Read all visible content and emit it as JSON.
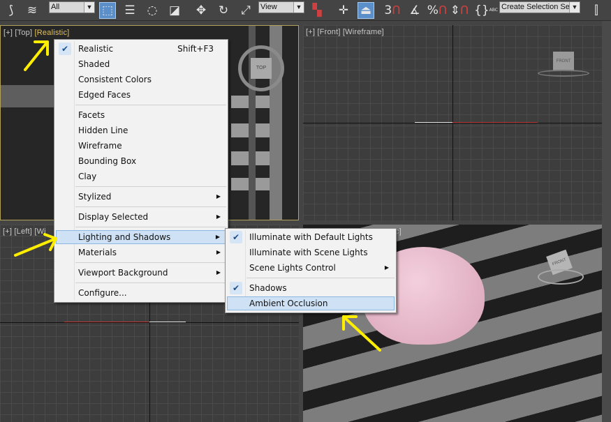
{
  "toolbar": {
    "selection_filter": "All",
    "ref_coord": "View",
    "selection_set_placeholder": "Create Selection Se",
    "snap_label": "3",
    "percent_label": "%",
    "abc_label": "ABC"
  },
  "viewports": {
    "top": {
      "plus": "[+]",
      "view": "[Top]",
      "shading": "[Realistic]"
    },
    "front": {
      "plus": "[+]",
      "view": "[Front]",
      "shading": "[Wireframe]",
      "cube_label": "FRONT"
    },
    "left": {
      "plus": "[+]",
      "view": "[Left]",
      "shading": "[Wi"
    },
    "persp": {
      "shading_tail": "tic]",
      "cube_label": "FRONT"
    },
    "top_cube_label": "TOP"
  },
  "shading_menu": {
    "items": [
      {
        "label": "Realistic",
        "shortcut": "Shift+F3",
        "checked": true
      },
      {
        "label": "Shaded"
      },
      {
        "label": "Consistent Colors"
      },
      {
        "label": "Edged Faces"
      },
      {
        "label": "Facets"
      },
      {
        "label": "Hidden Line"
      },
      {
        "label": "Wireframe"
      },
      {
        "label": "Bounding Box"
      },
      {
        "label": "Clay"
      },
      {
        "label": "Stylized",
        "submenu": true
      },
      {
        "label": "Display Selected",
        "submenu": true
      },
      {
        "label": "Lighting and Shadows",
        "submenu": true,
        "highlighted": true
      },
      {
        "label": "Materials",
        "submenu": true
      },
      {
        "label": "Viewport Background",
        "submenu": true
      },
      {
        "label": "Configure..."
      }
    ]
  },
  "lighting_menu": {
    "items": [
      {
        "label": "Illuminate with Default Lights",
        "checked": true
      },
      {
        "label": "Illuminate with Scene Lights"
      },
      {
        "label": "Scene Lights Control",
        "submenu": true
      },
      {
        "label": "Shadows",
        "checked": true
      },
      {
        "label": "Ambient Occlusion",
        "highlighted": true
      }
    ]
  },
  "colors": {
    "accent_blue": "#5b8fc9",
    "menu_highlight": "#cfe2f5",
    "annotation_yellow": "#ffee00",
    "active_viewport_border": "#b3a35a",
    "dome_pink": "#e8b4c8"
  },
  "glyphs": {
    "check": "✔",
    "submenu_arrow": "▶",
    "dropdown_arrow": "▼"
  }
}
